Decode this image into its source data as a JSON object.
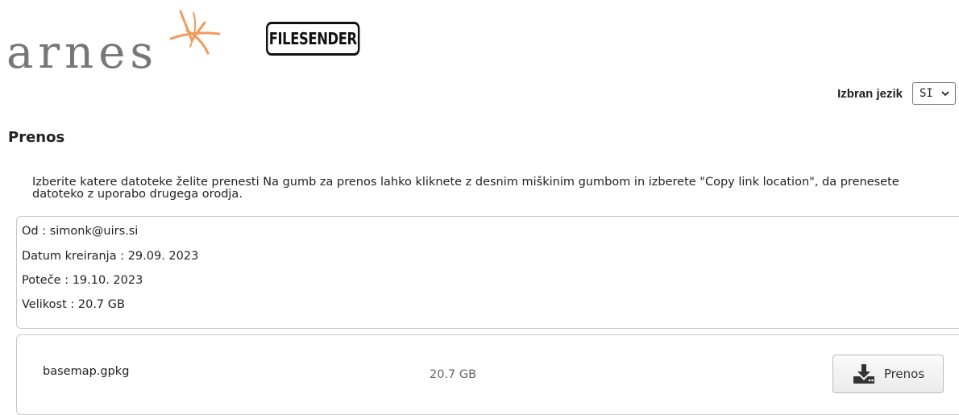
{
  "header": {
    "arnes_logo_text": "arnes",
    "filesender_logo_text": "FILESENDER"
  },
  "language": {
    "label": "Izbran jezik",
    "selected": "SI"
  },
  "page": {
    "title": "Prenos",
    "instructions": "Izberite katere datoteke želite prenesti Na gumb za prenos lahko kliknete z desnim miškinim gumbom in izberete \"Copy link location\", da prenesete datoteko z uporabo drugega orodja."
  },
  "transfer_info": {
    "from": "Od : simonk@uirs.si",
    "created": "Datum kreiranja : 29.09. 2023",
    "expires": "Poteče : 19.10. 2023",
    "size": "Velikost : 20.7 GB"
  },
  "files": [
    {
      "name": "basemap.gpkg",
      "size": "20.7 GB",
      "download_label": "Prenos"
    }
  ],
  "colors": {
    "logo_orange": "#f39a5a",
    "logo_gray": "#777777",
    "border": "#c8c8c8"
  }
}
